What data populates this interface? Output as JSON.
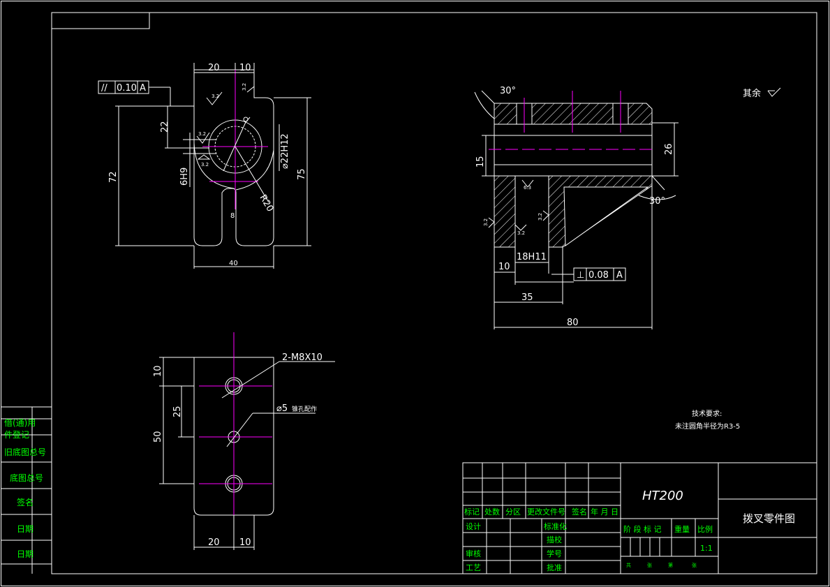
{
  "drawing": {
    "colors": {
      "background": "#000000",
      "lines": "#ffffff",
      "centerlines": "#ff00ff",
      "labels_green": "#00ff00"
    }
  },
  "front_view": {
    "tolerance": {
      "symbol": "//",
      "value": "0.10",
      "datum": "A"
    },
    "dims": {
      "top_20": "20",
      "top_10": "10",
      "h22": "22",
      "h72": "72",
      "h75": "75",
      "r6h9": "6H9",
      "phi22h12": "⌀22H12",
      "r20": "R20",
      "bottom_40": "40",
      "slot_8": "8"
    },
    "roughness": {
      "r1": "3.2",
      "r2": "3.2",
      "r3": "3.2",
      "r4": "3.2"
    }
  },
  "side_view": {
    "angle_top": "30°",
    "angle_bottom": "30°",
    "dims": {
      "d26": "26",
      "d15": "15",
      "d10": "10",
      "d18h11": "18H11",
      "d35": "35",
      "d80": "80"
    },
    "tolerance": {
      "symbol": "⊥",
      "value": "0.08",
      "datum": "A"
    },
    "roughness": {
      "r1": "6.3",
      "r2": "3.2",
      "r3": "3.2",
      "r4": "3.2"
    }
  },
  "top_view": {
    "callout_thread": "2-M8X10",
    "callout_hole": "⌀5",
    "callout_hole_note": "锥孔配作",
    "dims": {
      "v10": "10",
      "v25": "25",
      "v50": "50",
      "b20": "20",
      "b10": "10"
    }
  },
  "other_note": {
    "label": "其余"
  },
  "tech_requirements": {
    "title": "技术要求:",
    "line1": "未注圆角半径为R3-5"
  },
  "left_strip": {
    "labels": [
      "借(通)用",
      "件登记",
      "旧底图总号",
      "底图总号",
      "签名",
      "日期",
      "日期"
    ]
  },
  "title_block": {
    "material": "HT200",
    "drawing_name": "拨叉零件图",
    "header_row": [
      "标记",
      "处数",
      "分区",
      "更改文件号",
      "签名",
      "年 月 日"
    ],
    "left_labels": [
      "设计",
      "审核",
      "工艺"
    ],
    "mid_labels": [
      "标准化",
      "描校",
      "学号",
      "批准"
    ],
    "stage_labels": [
      "阶 段 标 记",
      "重量",
      "比例"
    ],
    "scale": "1:1",
    "sheet_row": [
      "共",
      "张",
      "第",
      "张"
    ]
  }
}
